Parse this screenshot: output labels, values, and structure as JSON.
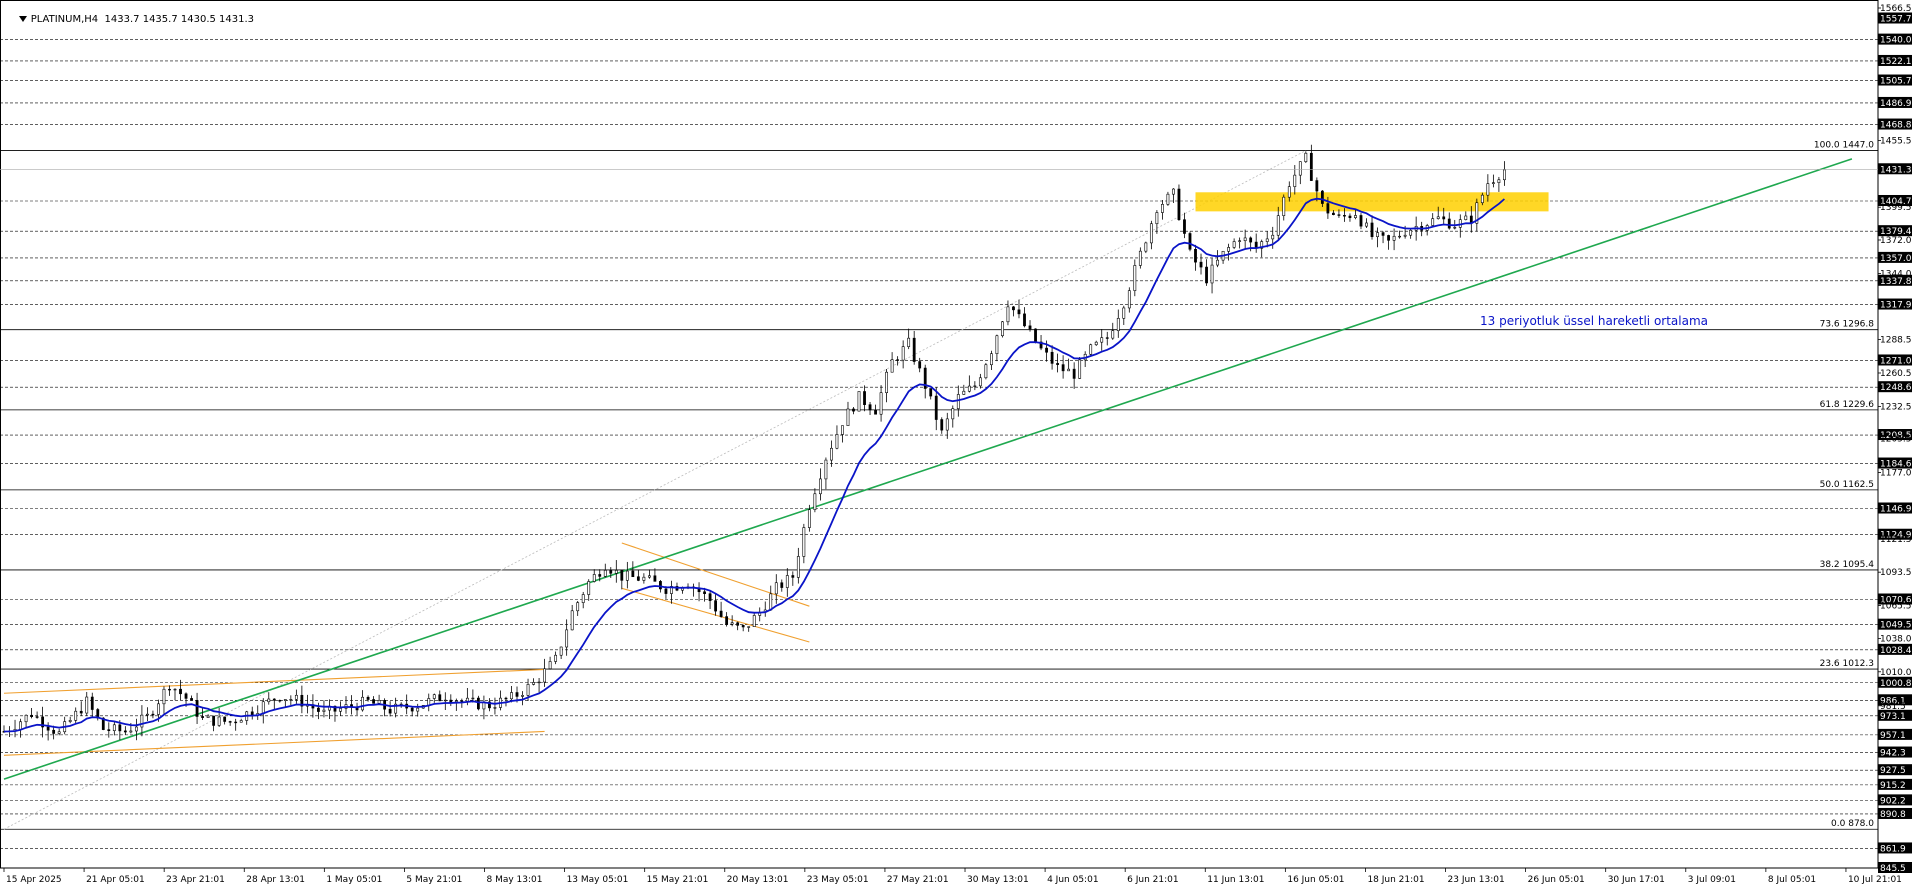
{
  "header": {
    "symbol": "PLATINUM,H4",
    "ohlc": "1433.7 1435.7 1430.5 1431.3"
  },
  "colors": {
    "background": "#ffffff",
    "candle": "#000000",
    "ema": "#0a14c8",
    "trendline": "#1fa84f",
    "channel": "#f0a030",
    "zone": "#ffd000",
    "grid": "#000000",
    "fib_diag": "#bbbbbb",
    "label_box": "#000000",
    "label_text": "#ffffff"
  },
  "annotation": "13 periyotluk üssel hareketli ortalama",
  "chart_data": {
    "type": "candlestick",
    "title": "PLATINUM,H4",
    "timeframe": "H4",
    "ylim": [
      845.5,
      1566.5
    ],
    "x_ticks": [
      "15 Apr 2025",
      "21 Apr 05:01",
      "23 Apr 21:01",
      "28 Apr 13:01",
      "1 May 05:01",
      "5 May 21:01",
      "8 May 13:01",
      "13 May 05:01",
      "15 May 21:01",
      "20 May 13:01",
      "23 May 05:01",
      "27 May 21:01",
      "30 May 13:01",
      "4 Jun 05:01",
      "6 Jun 21:01",
      "11 Jun 13:01",
      "16 Jun 05:01",
      "18 Jun 21:01",
      "23 Jun 13:01",
      "26 Jun 05:01",
      "30 Jun 17:01",
      "3 Jul 09:01",
      "8 Jul 05:01",
      "10 Jul 21:01"
    ],
    "y_ticks": [
      "1566.5",
      "1540.0",
      "1522.1",
      "1505.7",
      "1486.9",
      "1468.8",
      "1455.5",
      "1431.3",
      "1404.7",
      "1399.5",
      "1379.4",
      "1372.0",
      "1357.0",
      "1344.0",
      "1337.8",
      "1317.9",
      "1288.5",
      "1271.0",
      "1260.5",
      "1248.6",
      "1232.5",
      "1208.5",
      "1205.5",
      "1184.6",
      "1177.0",
      "1146.9",
      "1124.9",
      "1121.5",
      "1093.5",
      "1070.6",
      "1065.5",
      "1049.5",
      "1038.0",
      "1028.4",
      "1010.0",
      "1000.8",
      "986.1",
      "981.5",
      "973.1",
      "957.1",
      "942.3",
      "927.5",
      "915.2",
      "902.2",
      "890.8",
      "861.9",
      "845.5"
    ],
    "highlighted_levels": [
      1540.0,
      1522.1,
      1505.7,
      1486.9,
      1468.8,
      1404.7,
      1379.4,
      1357.0,
      1337.8,
      1317.9,
      1271.0,
      1248.6,
      1208.5,
      1184.6,
      1146.9,
      1124.9,
      1070.6,
      1049.5,
      1028.4,
      1000.8,
      986.1,
      973.1,
      957.1,
      942.3,
      927.5,
      915.2,
      902.2,
      890.8,
      861.9,
      845.5
    ],
    "current_price": 1431.3,
    "header_price": 1557.7,
    "fibonacci": [
      {
        "label": "100.0 1447.0",
        "value": 1447.0
      },
      {
        "label": "73.6 1296.8",
        "value": 1296.8
      },
      {
        "label": "61.8 1229.6",
        "value": 1229.6
      },
      {
        "label": "50.0 1162.5",
        "value": 1162.5
      },
      {
        "label": "38.2 1095.4",
        "value": 1095.4
      },
      {
        "label": "23.6 1012.3",
        "value": 1012.3
      },
      {
        "label": "0.0 878.0",
        "value": 878.0
      }
    ],
    "price_path": [
      [
        0,
        960
      ],
      [
        5,
        975
      ],
      [
        10,
        958
      ],
      [
        15,
        985
      ],
      [
        18,
        962
      ],
      [
        22,
        960
      ],
      [
        26,
        972
      ],
      [
        30,
        1000
      ],
      [
        33,
        988
      ],
      [
        36,
        970
      ],
      [
        41,
        968
      ],
      [
        46,
        980
      ],
      [
        50,
        990
      ],
      [
        54,
        985
      ],
      [
        58,
        975
      ],
      [
        62,
        980
      ],
      [
        66,
        985
      ],
      [
        70,
        978
      ],
      [
        75,
        982
      ],
      [
        80,
        990
      ],
      [
        84,
        984
      ],
      [
        88,
        982
      ],
      [
        92,
        988
      ],
      [
        96,
        1000
      ],
      [
        100,
        1020
      ],
      [
        103,
        1060
      ],
      [
        106,
        1085
      ],
      [
        109,
        1100
      ],
      [
        112,
        1090
      ],
      [
        116,
        1088
      ],
      [
        120,
        1080
      ],
      [
        124,
        1085
      ],
      [
        128,
        1070
      ],
      [
        131,
        1050
      ],
      [
        134,
        1045
      ],
      [
        137,
        1060
      ],
      [
        140,
        1080
      ],
      [
        143,
        1090
      ],
      [
        146,
        1150
      ],
      [
        149,
        1190
      ],
      [
        152,
        1220
      ],
      [
        155,
        1240
      ],
      [
        158,
        1230
      ],
      [
        161,
        1270
      ],
      [
        164,
        1285
      ],
      [
        167,
        1250
      ],
      [
        170,
        1210
      ],
      [
        173,
        1240
      ],
      [
        176,
        1250
      ],
      [
        179,
        1280
      ],
      [
        182,
        1320
      ],
      [
        185,
        1300
      ],
      [
        188,
        1280
      ],
      [
        191,
        1265
      ],
      [
        194,
        1260
      ],
      [
        197,
        1280
      ],
      [
        200,
        1290
      ],
      [
        203,
        1320
      ],
      [
        206,
        1360
      ],
      [
        209,
        1400
      ],
      [
        212,
        1410
      ],
      [
        215,
        1360
      ],
      [
        218,
        1340
      ],
      [
        221,
        1360
      ],
      [
        224,
        1375
      ],
      [
        227,
        1365
      ],
      [
        230,
        1380
      ],
      [
        233,
        1420
      ],
      [
        236,
        1440
      ],
      [
        239,
        1400
      ],
      [
        242,
        1390
      ],
      [
        245,
        1395
      ],
      [
        248,
        1375
      ],
      [
        251,
        1370
      ],
      [
        254,
        1380
      ],
      [
        257,
        1385
      ],
      [
        260,
        1390
      ],
      [
        263,
        1385
      ],
      [
        266,
        1390
      ],
      [
        269,
        1420
      ],
      [
        272,
        1431
      ]
    ],
    "series": [
      {
        "name": "13 periyotluk üssel hareketli ortalama",
        "type": "ema",
        "period": 13
      }
    ],
    "trendline": {
      "from": [
        0,
        920
      ],
      "to": [
        335,
        1440
      ]
    },
    "channels": [
      {
        "name": "rising channel",
        "upper": [
          [
            0,
            992
          ],
          [
            98,
            1012
          ]
        ],
        "lower": [
          [
            0,
            940
          ],
          [
            98,
            960
          ]
        ]
      },
      {
        "name": "falling channel",
        "upper": [
          [
            112,
            1118
          ],
          [
            146,
            1065
          ]
        ],
        "lower": [
          [
            112,
            1080
          ],
          [
            146,
            1035
          ]
        ]
      }
    ],
    "zone": {
      "from_index": 216,
      "to_index": 280,
      "top": 1412,
      "bottom": 1396
    },
    "grid": true,
    "legend": "none"
  }
}
